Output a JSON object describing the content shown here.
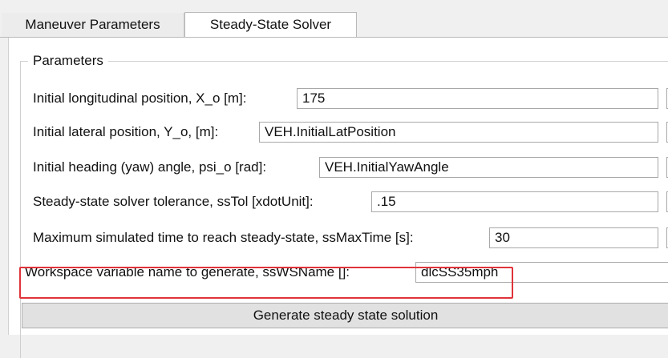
{
  "tabs": [
    {
      "label": "Maneuver Parameters",
      "active": false
    },
    {
      "label": "Steady-State Solver",
      "active": true
    }
  ],
  "group": {
    "title": "Parameters"
  },
  "params": [
    {
      "label": "Initial longitudinal position, X_o [m]:",
      "value": "175"
    },
    {
      "label": "Initial lateral position, Y_o, [m]:",
      "value": "VEH.InitialLatPosition"
    },
    {
      "label": "Initial heading (yaw) angle, psi_o [rad]:",
      "value": "VEH.InitialYawAngle"
    },
    {
      "label": "Steady-state solver tolerance, ssTol [xdotUnit]:",
      "value": ".15"
    },
    {
      "label": "Maximum simulated time to reach steady-state, ssMaxTime [s]:",
      "value": "30"
    },
    {
      "label": "Workspace variable name to generate, ssWSName []:",
      "value": "dlcSS35mph"
    }
  ],
  "generate_button": {
    "label": "Generate steady state solution"
  },
  "colors": {
    "highlight": "#e0333a",
    "panel_background": "#ffffff",
    "window_background": "#f0f0f0"
  },
  "icons": {
    "param_menu": "vertical-ellipsis-icon"
  }
}
